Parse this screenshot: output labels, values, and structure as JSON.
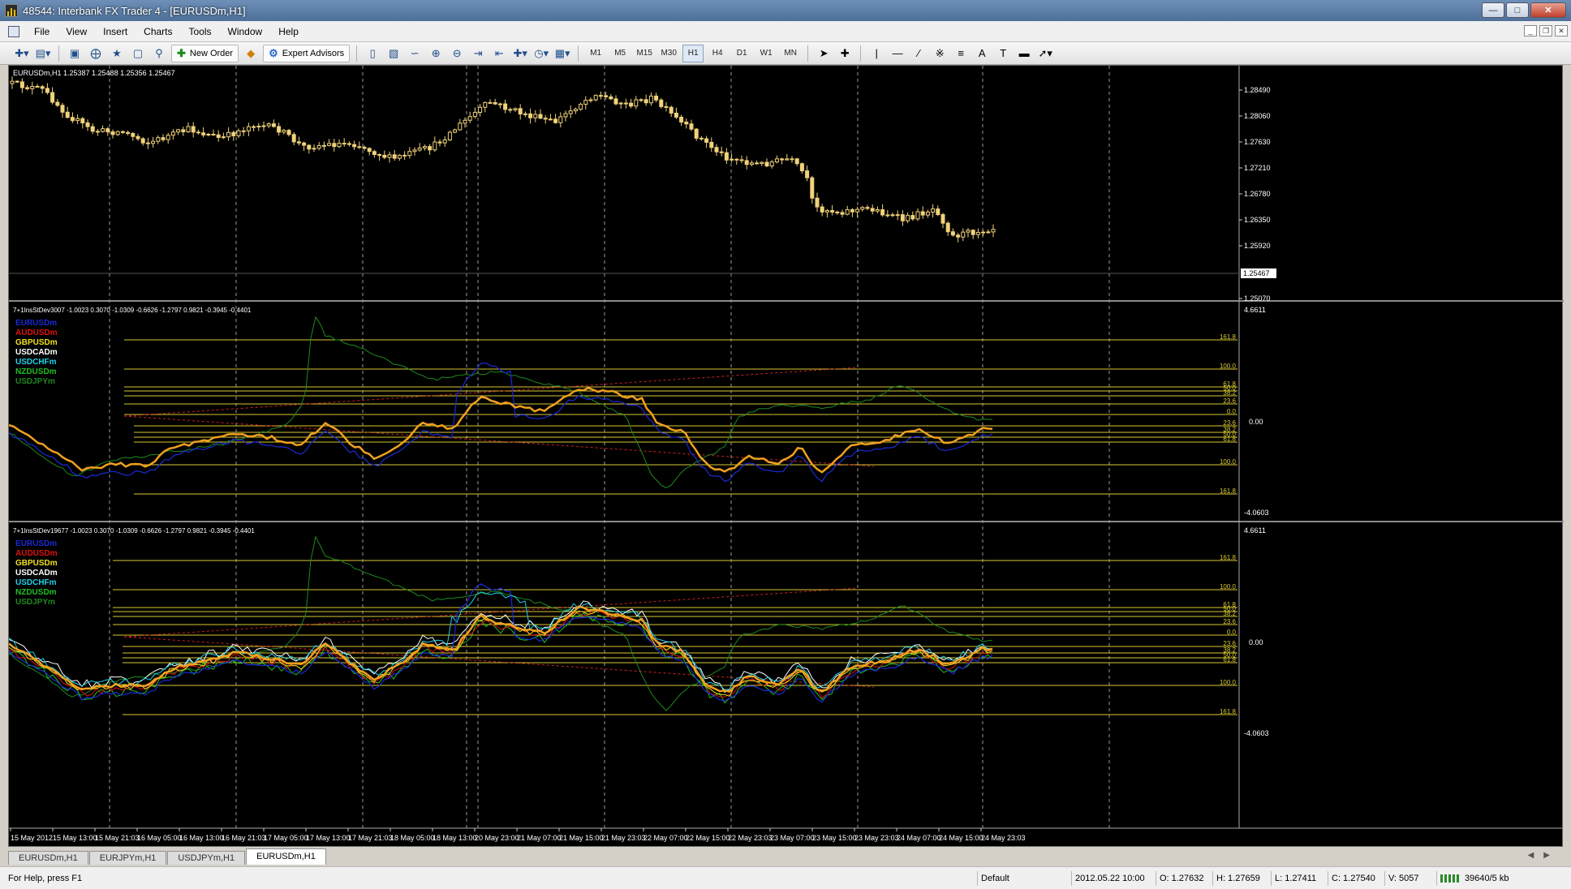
{
  "window": {
    "title": "48544: Interbank FX Trader 4 - [EURUSDm,H1]"
  },
  "menu": [
    "File",
    "View",
    "Insert",
    "Charts",
    "Tools",
    "Window",
    "Help"
  ],
  "toolbar": {
    "new_order": "New Order",
    "expert_advisors": "Expert Advisors",
    "timeframes": [
      "M1",
      "M5",
      "M15",
      "M30",
      "H1",
      "H4",
      "D1",
      "W1",
      "MN"
    ],
    "active_timeframe": "H1"
  },
  "main_chart": {
    "header": "EURUSDm,H1  1.25387 1.25488 1.25356 1.25467",
    "price_labels": [
      "1.28490",
      "1.28060",
      "1.27630",
      "1.27210",
      "1.26780",
      "1.26350",
      "1.25920",
      "1.25467",
      "1.25070"
    ],
    "current_price": "1.25467",
    "candle_color": "#f0d27a"
  },
  "indicator1": {
    "header": "7+1InsStDev3007 -1.0023 0.3070 -1.0309 -0.6626 -1.2797 0.9821 -0.3945 -0.4401",
    "scale_top": "4.6611",
    "scale_mid": "0.00",
    "scale_bottom": "-4.0603"
  },
  "indicator2": {
    "header": "7+1InsStDev19677 -1.0023 0.3070 -1.0309 -0.6626 -1.2797 0.9821 -0.3945 -0.4401",
    "scale_top": "4.6611",
    "scale_mid": "0.00",
    "scale_bottom": "-4.0603"
  },
  "legend": [
    {
      "name": "EURUSDm",
      "color": "#1a2ad6"
    },
    {
      "name": "AUDUSDm",
      "color": "#e01010"
    },
    {
      "name": "GBPUSDm",
      "color": "#f0e020"
    },
    {
      "name": "USDCADm",
      "color": "#ffffff"
    },
    {
      "name": "USDCHFm",
      "color": "#20d0e8"
    },
    {
      "name": "NZDUSDm",
      "color": "#20c020"
    },
    {
      "name": "USDJPYm",
      "color": "#1e8a1e"
    }
  ],
  "fib_upper_labels": [
    "161.8",
    "100.0",
    "61.8",
    "50.0",
    "38.2",
    "23.6",
    "0.0"
  ],
  "fib_lower_labels": [
    "23.6",
    "38.2",
    "50.0",
    "61.8",
    "100.0",
    "161.8"
  ],
  "time_axis": [
    "15 May 2012",
    "15 May 13:00",
    "15 May 21:03",
    "16 May 05:00",
    "16 May 13:00",
    "16 May 21:03",
    "17 May 05:00",
    "17 May 13:00",
    "17 May 21:03",
    "18 May 05:00",
    "18 May 13:00",
    "20 May 23:00",
    "21 May 07:00",
    "21 May 15:00",
    "21 May 23:03",
    "22 May 07:00",
    "22 May 15:00",
    "22 May 23:03",
    "23 May 07:00",
    "23 May 15:00",
    "23 May 23:03",
    "24 May 07:00",
    "24 May 15:00",
    "24 May 23:03"
  ],
  "chart_tabs": [
    "EURUSDm,H1",
    "EURJPYm,H1",
    "USDJPYm,H1",
    "EURUSDm,H1"
  ],
  "active_tab": 3,
  "status": {
    "help": "For Help, press F1",
    "profile": "Default",
    "datetime": "2012.05.22 10:00",
    "open": "O: 1.27632",
    "high": "H: 1.27659",
    "low": "L: 1.27411",
    "close": "C: 1.27540",
    "volume": "V: 5057",
    "traffic": "39640/5 kb"
  },
  "colors": {
    "background": "#000000",
    "grid": "#9a9a9a",
    "fib": "#d8c832",
    "main_series": "#f0a020",
    "trendline": "#d02020"
  }
}
